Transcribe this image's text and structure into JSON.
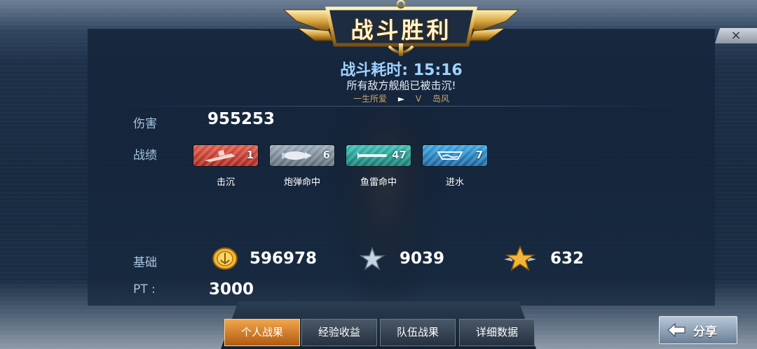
{
  "header": {
    "title": "战斗胜利",
    "time_label": "战斗耗时: 15:16",
    "message": "所有敌方舰船已被击沉!",
    "player": "一生所爱",
    "versus": "V",
    "enemy": "岛风",
    "close_symbol": "×"
  },
  "stats": {
    "damage_label": "伤害",
    "damage_value": "955253",
    "record_label": "战绩",
    "badges": [
      {
        "icon": "sink-ship-icon",
        "count": "1",
        "caption": "击沉"
      },
      {
        "icon": "shell-icon",
        "count": "6",
        "caption": "炮弹命中"
      },
      {
        "icon": "torpedo-icon",
        "count": "47",
        "caption": "鱼雷命中"
      },
      {
        "icon": "flood-icon",
        "count": "7",
        "caption": "进水"
      }
    ],
    "base_label": "基础",
    "coins": "596978",
    "silver_stars": "9039",
    "gold_stars": "632",
    "pt_label": "PT :",
    "pt_value": "3000"
  },
  "nav": {
    "tabs": [
      "个人战果",
      "经验收益",
      "队伍战果",
      "详细数据"
    ],
    "active_index": 0
  },
  "share": {
    "label": "分享"
  },
  "colors": {
    "gold": "#f2a64a",
    "accent_blue": "#9fd2ff"
  }
}
